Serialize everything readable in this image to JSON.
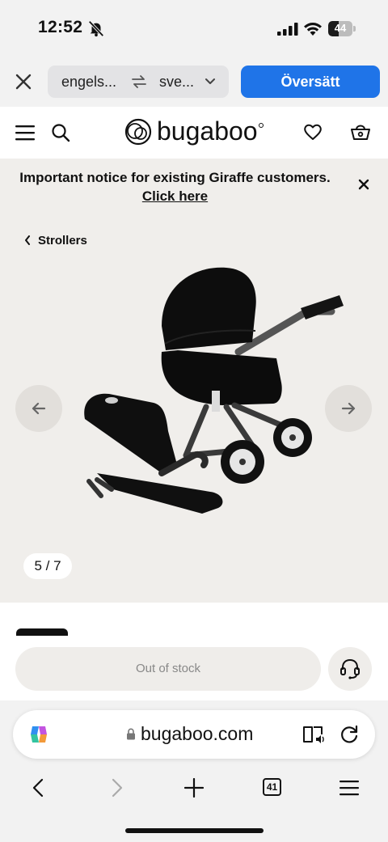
{
  "status_bar": {
    "time": "12:52",
    "battery_level": "44",
    "battery_fraction": 0.44
  },
  "translate_bar": {
    "from_language": "engels...",
    "to_language": "sve...",
    "translate_button": "Översätt"
  },
  "site": {
    "logo_text": "bugaboo"
  },
  "notice": {
    "text": "Important notice for existing Giraffe customers.",
    "link": "Click here"
  },
  "gallery": {
    "breadcrumb": "Strollers",
    "counter": "5 / 7"
  },
  "product": {
    "stock_button": "Out of stock"
  },
  "browser": {
    "url": "bugaboo.com",
    "tab_count": "41"
  },
  "colors": {
    "accent": "#1f74e8",
    "notice_bg": "#f0eeeb",
    "stroller": "#111111"
  }
}
